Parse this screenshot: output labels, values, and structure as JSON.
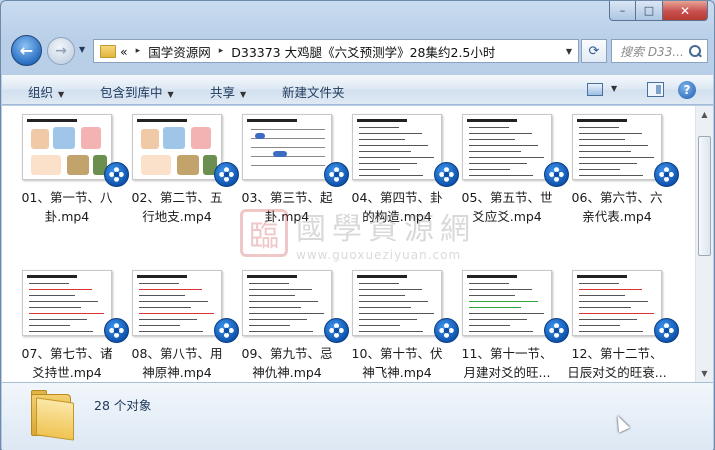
{
  "window": {
    "caption": {
      "minimize": "–",
      "maximize": "□",
      "close": "✕"
    }
  },
  "address": {
    "prefix": "«",
    "crumbs": [
      "国学资源网",
      "D33373 大鸡腿《六爻预测学》28集约2.5小时"
    ],
    "separator": "▸"
  },
  "search": {
    "placeholder": "搜索 D33..."
  },
  "toolbar": {
    "organize": "组织",
    "include_in_library": "包含到库中",
    "share": "共享",
    "new_folder": "新建文件夹"
  },
  "files": [
    {
      "line1": "01、第一节、八",
      "line2": "卦.mp4",
      "thumb": "illustration"
    },
    {
      "line1": "02、第二节、五",
      "line2": "行地支.mp4",
      "thumb": "illustration"
    },
    {
      "line1": "03、第三节、起",
      "line2": "卦.mp4",
      "thumb": "table"
    },
    {
      "line1": "04、第四节、卦",
      "line2": "的构造.mp4",
      "thumb": "text"
    },
    {
      "line1": "05、第五节、世",
      "line2": "爻应爻.mp4",
      "thumb": "text"
    },
    {
      "line1": "06、第六节、六",
      "line2": "亲代表.mp4",
      "thumb": "text"
    },
    {
      "line1": "07、第七节、诸",
      "line2": "爻持世.mp4",
      "thumb": "redtext"
    },
    {
      "line1": "08、第八节、用",
      "line2": "神原神.mp4",
      "thumb": "redtext"
    },
    {
      "line1": "09、第九节、忌",
      "line2": "神仇神.mp4",
      "thumb": "text"
    },
    {
      "line1": "10、第十节、伏",
      "line2": "神飞神.mp4",
      "thumb": "text"
    },
    {
      "line1": "11、第十一节、",
      "line2": "月建对爻的旺...",
      "thumb": "green"
    },
    {
      "line1": "12、第十二节、",
      "line2": "日辰对爻的旺衰...",
      "thumb": "redtext"
    }
  ],
  "watermark": {
    "seal": "臨",
    "text": "國學資源網",
    "url": "www.guoxueziyuan.com"
  },
  "status": {
    "count": "28 个对象"
  }
}
